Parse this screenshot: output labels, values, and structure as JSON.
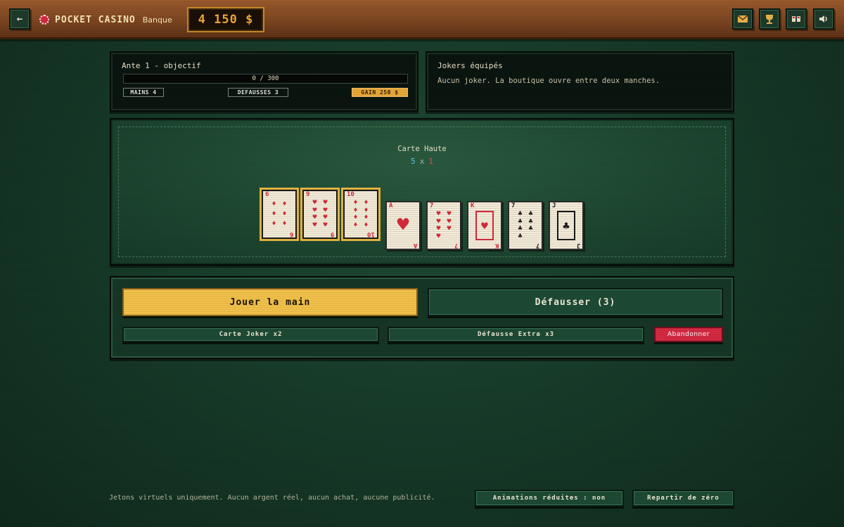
{
  "header": {
    "back_icon": "←",
    "brand": "POCKET CASINO",
    "bank_label": "Banque",
    "bank_value": "4 150 $",
    "icons": [
      "mail-icon",
      "trophy-icon",
      "card-icon",
      "speaker-icon"
    ]
  },
  "objective": {
    "title": "Ante 1 - objectif",
    "progress": 0,
    "progress_text": "0 / 300",
    "hands": "MAINS 4",
    "discards": "DEFAUSSES 3",
    "reward": "GAIN 250 $"
  },
  "jokers": {
    "title": "Jokers équipés",
    "description": "Aucun joker. La boutique ouvre entre deux manches."
  },
  "table": {
    "hand_name": "Carte Haute",
    "chips": "5",
    "times": "x",
    "mult": "1",
    "cards": [
      {
        "rank": "6",
        "suit": "♦",
        "color": "red",
        "selected": true
      },
      {
        "rank": "9",
        "suit": "♥",
        "color": "red",
        "selected": true
      },
      {
        "rank": "10",
        "suit": "♦",
        "color": "red",
        "selected": true
      },
      {
        "rank": "A",
        "suit": "♥",
        "color": "red",
        "selected": false
      },
      {
        "rank": "7",
        "suit": "♥",
        "color": "red",
        "selected": false
      },
      {
        "rank": "K",
        "suit": "♥",
        "color": "red",
        "selected": false
      },
      {
        "rank": "7",
        "suit": "♣",
        "color": "black",
        "selected": false
      },
      {
        "rank": "J",
        "suit": "♣",
        "color": "black",
        "selected": false
      }
    ]
  },
  "actions": {
    "play": "Jouer la main",
    "discard": "Défausser (3)",
    "joker_card": "Carte Joker x2",
    "extra_discard": "Défausse Extra x3",
    "quit": "Abandonner"
  },
  "footer": {
    "disclaimer": "Jetons virtuels uniquement. Aucun argent réel, aucun achat, aucune publicité.",
    "reduced_animations": "Animations réduites : non",
    "reset": "Repartir de zéro"
  }
}
